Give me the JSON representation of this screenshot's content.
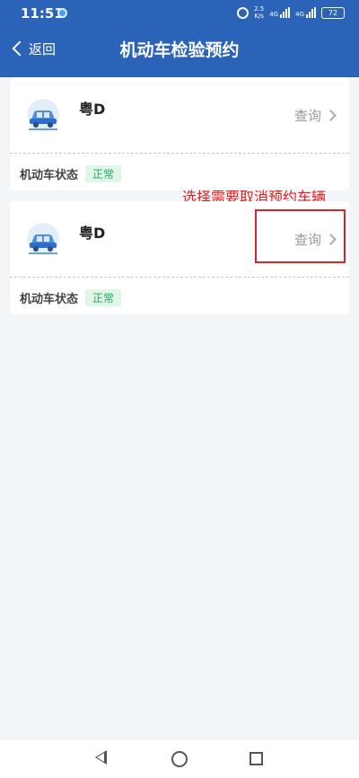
{
  "status_bar": {
    "time": "11:51",
    "speed": "2.5\nK/s",
    "network": "4G",
    "battery": "72"
  },
  "header": {
    "back_label": "返回",
    "title": "机动车检验预约"
  },
  "vehicles": [
    {
      "plate": "粤D",
      "query_label": "查询",
      "status_label": "机动车状态",
      "status_value": "正常"
    },
    {
      "plate": "粤D",
      "query_label": "查询",
      "status_label": "机动车状态",
      "status_value": "正常"
    }
  ],
  "annotation": {
    "text": "选择需要取消预约车辆",
    "color": "#e1201f"
  },
  "colors": {
    "header_bg": "#2b63b8",
    "badge_green": "#28a55f"
  },
  "icons": [
    "location-icon",
    "alarm-icon",
    "signal-icon",
    "battery-icon",
    "back-chevron-icon",
    "car-icon",
    "chevron-right-icon",
    "nav-back-icon",
    "nav-home-icon",
    "nav-recent-icon"
  ]
}
